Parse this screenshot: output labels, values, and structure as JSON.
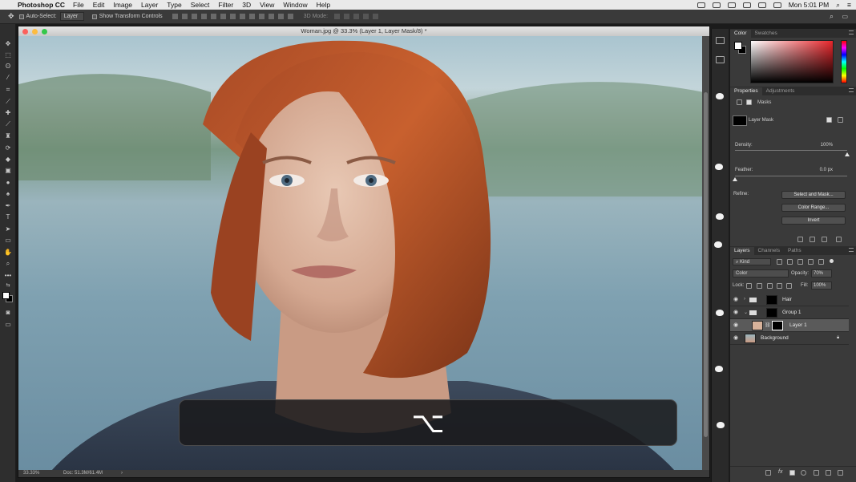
{
  "menubar": {
    "app_name": "Photoshop CC",
    "items": [
      "File",
      "Edit",
      "Image",
      "Layer",
      "Type",
      "Select",
      "Filter",
      "3D",
      "View",
      "Window",
      "Help"
    ],
    "clock": "Mon 5:01 PM"
  },
  "options": {
    "auto_select_label": "Auto-Select:",
    "auto_select_value": "Layer",
    "transform_label": "Show Transform Controls",
    "mode_label": "3D Mode:"
  },
  "document": {
    "title": "Woman.jpg @ 33.3% (Layer 1, Layer Mask/8) *",
    "zoom": "33.33%",
    "doc_size": "Doc: 51.3M/61.4M"
  },
  "key_overlay": {
    "glyph": "⌥"
  },
  "color_panel": {
    "tabs": [
      "Color",
      "Swatches"
    ],
    "fg_color": "#ffffff",
    "bg_color": "#000000"
  },
  "properties": {
    "tabs": [
      "Properties",
      "Adjustments"
    ],
    "section_label": "Masks",
    "mask_label": "Layer Mask",
    "density_label": "Density:",
    "density_value": "100%",
    "density_level": 1.0,
    "feather_label": "Feather:",
    "feather_value": "0.0 px",
    "feather_level": 0.0,
    "refine_label": "Refine:",
    "buttons": [
      "Select and Mask...",
      "Color Range...",
      "Invert"
    ]
  },
  "layers": {
    "tabs": [
      "Layers",
      "Channels",
      "Paths"
    ],
    "filter_label": "Kind",
    "blend_mode": "Color",
    "opacity_label": "Opacity:",
    "opacity_value": "70%",
    "lock_label": "Lock:",
    "fill_label": "Fill:",
    "fill_value": "100%",
    "items": [
      {
        "name": "Hair"
      },
      {
        "name": "Group 1"
      },
      {
        "name": "Layer 1"
      },
      {
        "name": "Background"
      }
    ],
    "footer_fx": "fx"
  },
  "colors": {
    "accent_skin": "#d8b29a",
    "selected_row": "#5a5a5a"
  }
}
